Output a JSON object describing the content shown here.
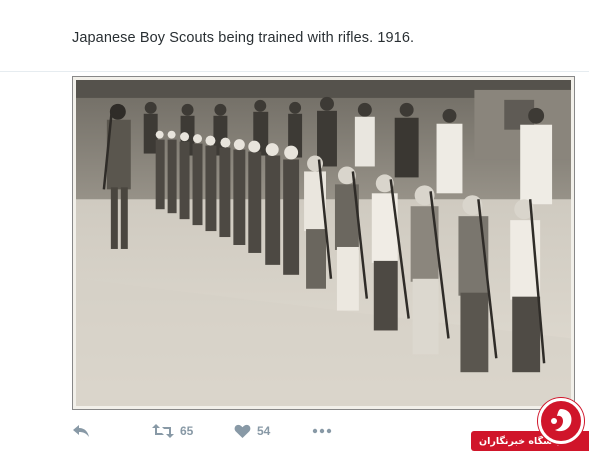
{
  "tweet": {
    "text": "Japanese Boy Scouts being trained with rifles. 1916.",
    "photo_alt": "Japanese Boy Scouts being trained with rifles. 1916."
  },
  "actions": {
    "reply_icon": "reply-icon",
    "retweet_icon": "retweet-icon",
    "retweet_count": "65",
    "like_icon": "heart-icon",
    "like_count": "54",
    "more_icon": "more-dots-icon"
  },
  "watermark": {
    "label": "باشگاه خبرنگاران",
    "brand_color": "#d0152a"
  },
  "colors": {
    "text": "#292f33",
    "action_gray": "#8899a6",
    "divider": "#e6ecf0"
  }
}
